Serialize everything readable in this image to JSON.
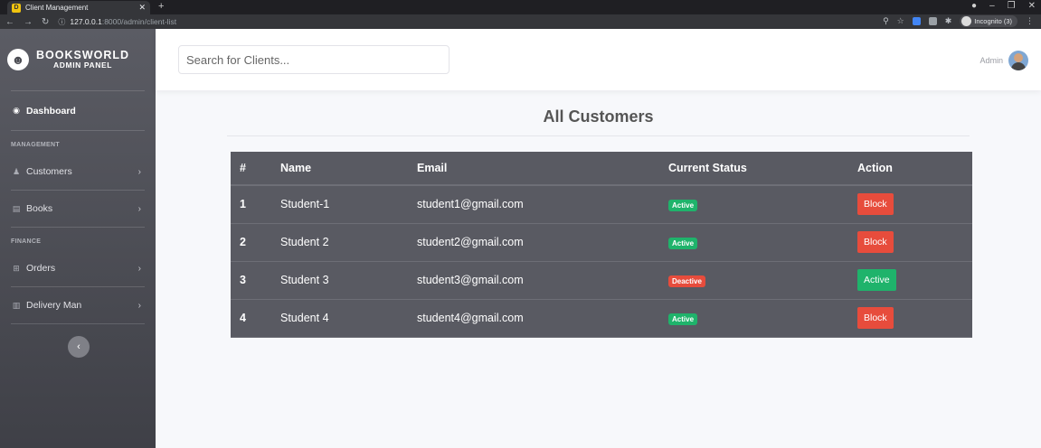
{
  "browser": {
    "tab_title": "Client Management",
    "favicon_letter": "D",
    "url_host": "127.0.0.1",
    "url_path": ":8000/admin/client-list",
    "incognito_label": "Incognito (3)"
  },
  "brand": {
    "name": "BOOKSWORLD",
    "subtitle": "ADMIN PANEL"
  },
  "sidebar": {
    "dashboard_label": "Dashboard",
    "sections": [
      {
        "heading": "MANAGEMENT",
        "items": [
          {
            "label": "Customers",
            "icon": "user-icon"
          },
          {
            "label": "Books",
            "icon": "book-icon"
          }
        ]
      },
      {
        "heading": "FINANCE",
        "items": [
          {
            "label": "Orders",
            "icon": "table-icon"
          },
          {
            "label": "Delivery Man",
            "icon": "chart-icon"
          }
        ]
      }
    ]
  },
  "topbar": {
    "search_placeholder": "Search for Clients...",
    "user_name": "Admin"
  },
  "page": {
    "title": "All Customers"
  },
  "table": {
    "headers": [
      "#",
      "Name",
      "Email",
      "Current Status",
      "Action"
    ],
    "rows": [
      {
        "num": "1",
        "name": "Student-1",
        "email": "student1@gmail.com",
        "status": "Active",
        "status_color": "#1fb36b",
        "action": "Block",
        "action_color": "#e74c3c"
      },
      {
        "num": "2",
        "name": "Student 2",
        "email": "student2@gmail.com",
        "status": "Active",
        "status_color": "#1fb36b",
        "action": "Block",
        "action_color": "#e74c3c"
      },
      {
        "num": "3",
        "name": "Student 3",
        "email": "student3@gmail.com",
        "status": "Deactive",
        "status_color": "#e74c3c",
        "action": "Active",
        "action_color": "#1fb36b"
      },
      {
        "num": "4",
        "name": "Student 4",
        "email": "student4@gmail.com",
        "status": "Active",
        "status_color": "#1fb36b",
        "action": "Block",
        "action_color": "#e74c3c"
      }
    ]
  },
  "colors": {
    "sidebar_bg": "#4f5058",
    "table_bg": "#595a62",
    "success": "#1fb36b",
    "danger": "#e74c3c"
  }
}
